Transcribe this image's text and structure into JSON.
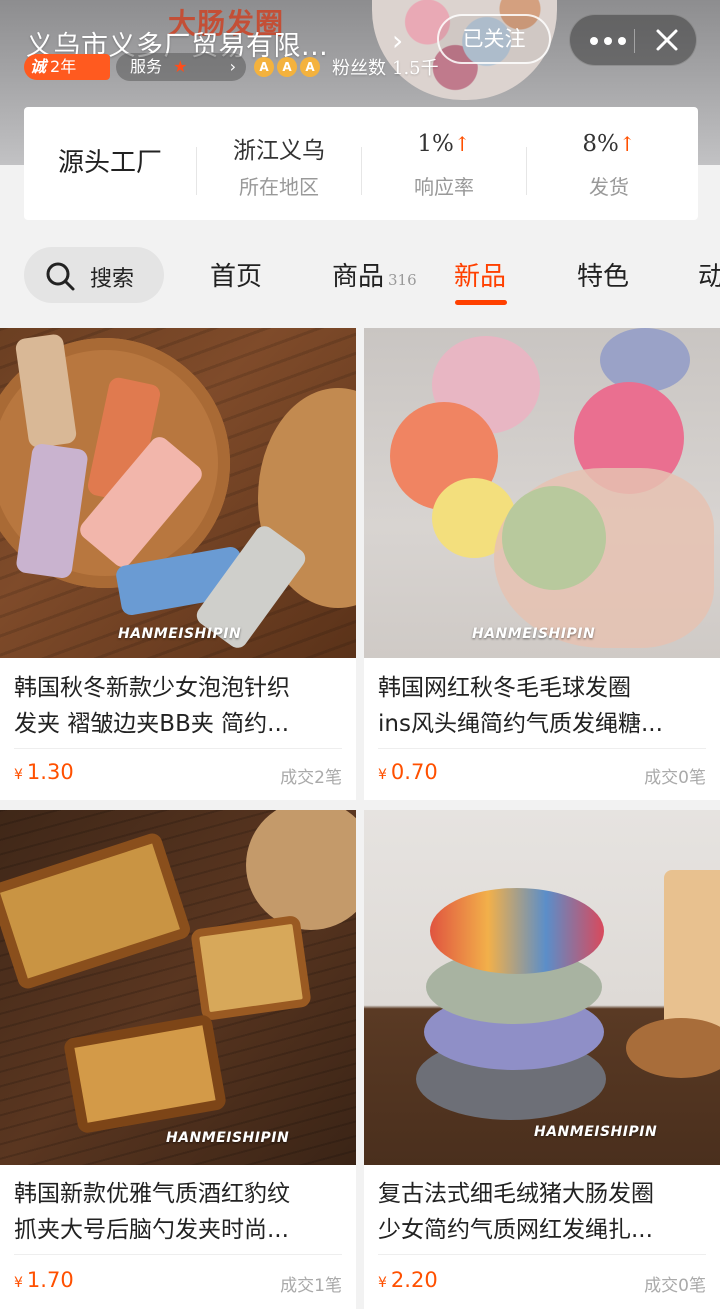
{
  "header": {
    "banner_text": "大肠发圈",
    "shop_name": "义乌市义多厂贸易有限...",
    "follow_label": "已关注",
    "cert_years": "2年",
    "cert_mark": "诚",
    "service_label": "服务",
    "fans_label": "粉丝数",
    "fans_value": "1.5千",
    "medal_glyph": "A"
  },
  "info": {
    "main": "源头工厂",
    "stats": [
      {
        "value": "浙江义乌",
        "label": "所在地区",
        "arrow": ""
      },
      {
        "value": "1%",
        "label": "响应率",
        "arrow": "↑"
      },
      {
        "value": "8%",
        "label": "发货",
        "arrow": "↑"
      }
    ]
  },
  "nav": {
    "search_label": "搜索",
    "tabs": [
      {
        "label": "首页",
        "count": ""
      },
      {
        "label": "商品",
        "count": "316"
      },
      {
        "label": "新品",
        "count": ""
      },
      {
        "label": "特色",
        "count": ""
      },
      {
        "label": "动",
        "count": ""
      }
    ],
    "active_tab": "新品"
  },
  "products": [
    {
      "title_line1": "韩国秋冬新款少女泡泡针织",
      "title_line2": "发夹 褶皱边夹BB夹 简约...",
      "currency": "¥",
      "price": "1.30",
      "sold": "成交2笔",
      "watermark": "HANMEISHIPIN"
    },
    {
      "title_line1": "韩国网红秋冬毛毛球发圈",
      "title_line2": "ins风头绳简约气质发绳糖...",
      "currency": "¥",
      "price": "0.70",
      "sold": "成交0笔",
      "watermark": "HANMEISHIPIN"
    },
    {
      "title_line1": "韩国新款优雅气质酒红豹纹",
      "title_line2": "抓夹大号后脑勺发夹时尚...",
      "currency": "¥",
      "price": "1.70",
      "sold": "成交1笔",
      "watermark": "HANMEISHIPIN"
    },
    {
      "title_line1": "复古法式细毛绒猪大肠发圈",
      "title_line2": "少女简约气质网红发绳扎...",
      "currency": "¥",
      "price": "2.20",
      "sold": "成交0笔",
      "watermark": "HANMEISHIPIN"
    }
  ],
  "colors": {
    "accent": "#ff5000",
    "active_tab": "#ff4000",
    "cert_badge": "#ff5a1f"
  }
}
